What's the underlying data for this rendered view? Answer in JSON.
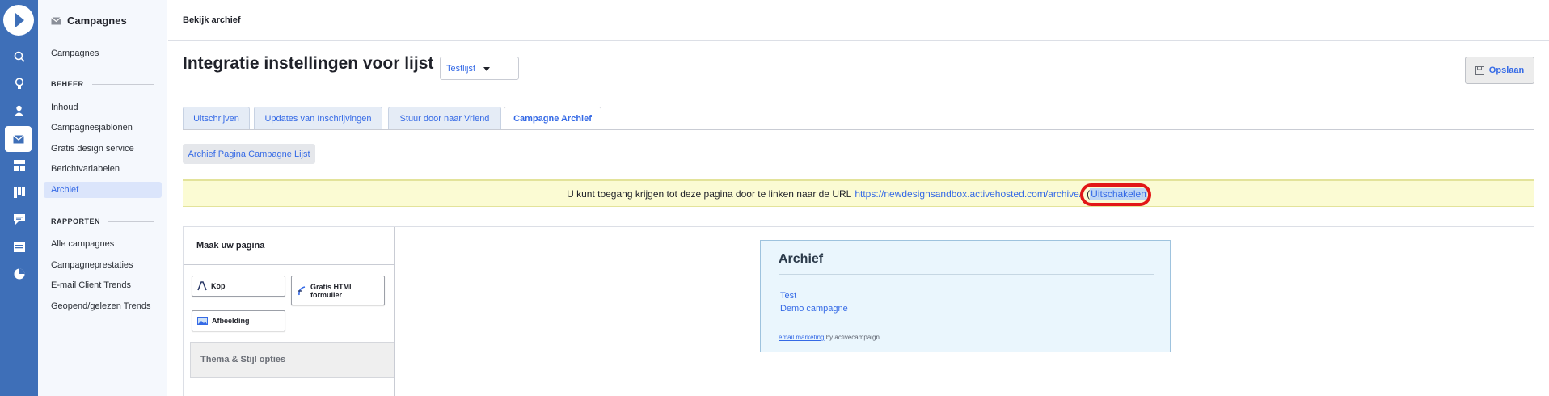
{
  "rail": {
    "icons": [
      "search-icon",
      "lightbulb-icon",
      "contacts-icon",
      "campaigns-icon",
      "automations-icon",
      "deals-icon",
      "conversations-icon",
      "site-icon",
      "reports-icon"
    ],
    "accent": "#3e6fb8"
  },
  "sidebar": {
    "title": "Campagnes",
    "campaigns_link": "Campagnes",
    "section_manage": "BEHEER",
    "manage_items": [
      "Inhoud",
      "Campagnesjablonen",
      "Gratis design service",
      "Berichtvariabelen",
      "Archief"
    ],
    "section_reports": "RAPPORTEN",
    "report_items": [
      "Alle campagnes",
      "Campagneprestaties",
      "E-mail Client Trends",
      "Geopend/gelezen Trends"
    ]
  },
  "header": {
    "breadcrumb": "Bekijk archief",
    "title": "Integratie instellingen voor lijst",
    "list_select_value": "Testlijst",
    "save_label": "Opslaan"
  },
  "tabs": [
    {
      "label": "Uitschrijven"
    },
    {
      "label": "Updates van Inschrijvingen"
    },
    {
      "label": "Stuur door naar Vriend"
    },
    {
      "label": "Campagne Archief"
    }
  ],
  "subtab": "Archief Pagina Campagne Lijst",
  "notice": {
    "text": "U kunt toegang krijgen tot deze pagina door te linken naar de URL",
    "url": "https://newdesignsandbox.activehosted.com/archive/",
    "open_paren": "(",
    "disable_label": "Uitschakelen",
    "close_paren": ")"
  },
  "builder": {
    "panel_title": "Maak uw pagina",
    "blocks": {
      "heading": "Kop",
      "html_form_line1": "Gratis HTML",
      "html_form_line2": "formulier",
      "image": "Afbeelding"
    },
    "theme_label": "Thema & Stijl opties"
  },
  "archive_preview": {
    "title": "Archief",
    "items": [
      "Test",
      "Demo campagne"
    ],
    "footer_link": "email marketing",
    "footer_text": " by activecampaign"
  }
}
